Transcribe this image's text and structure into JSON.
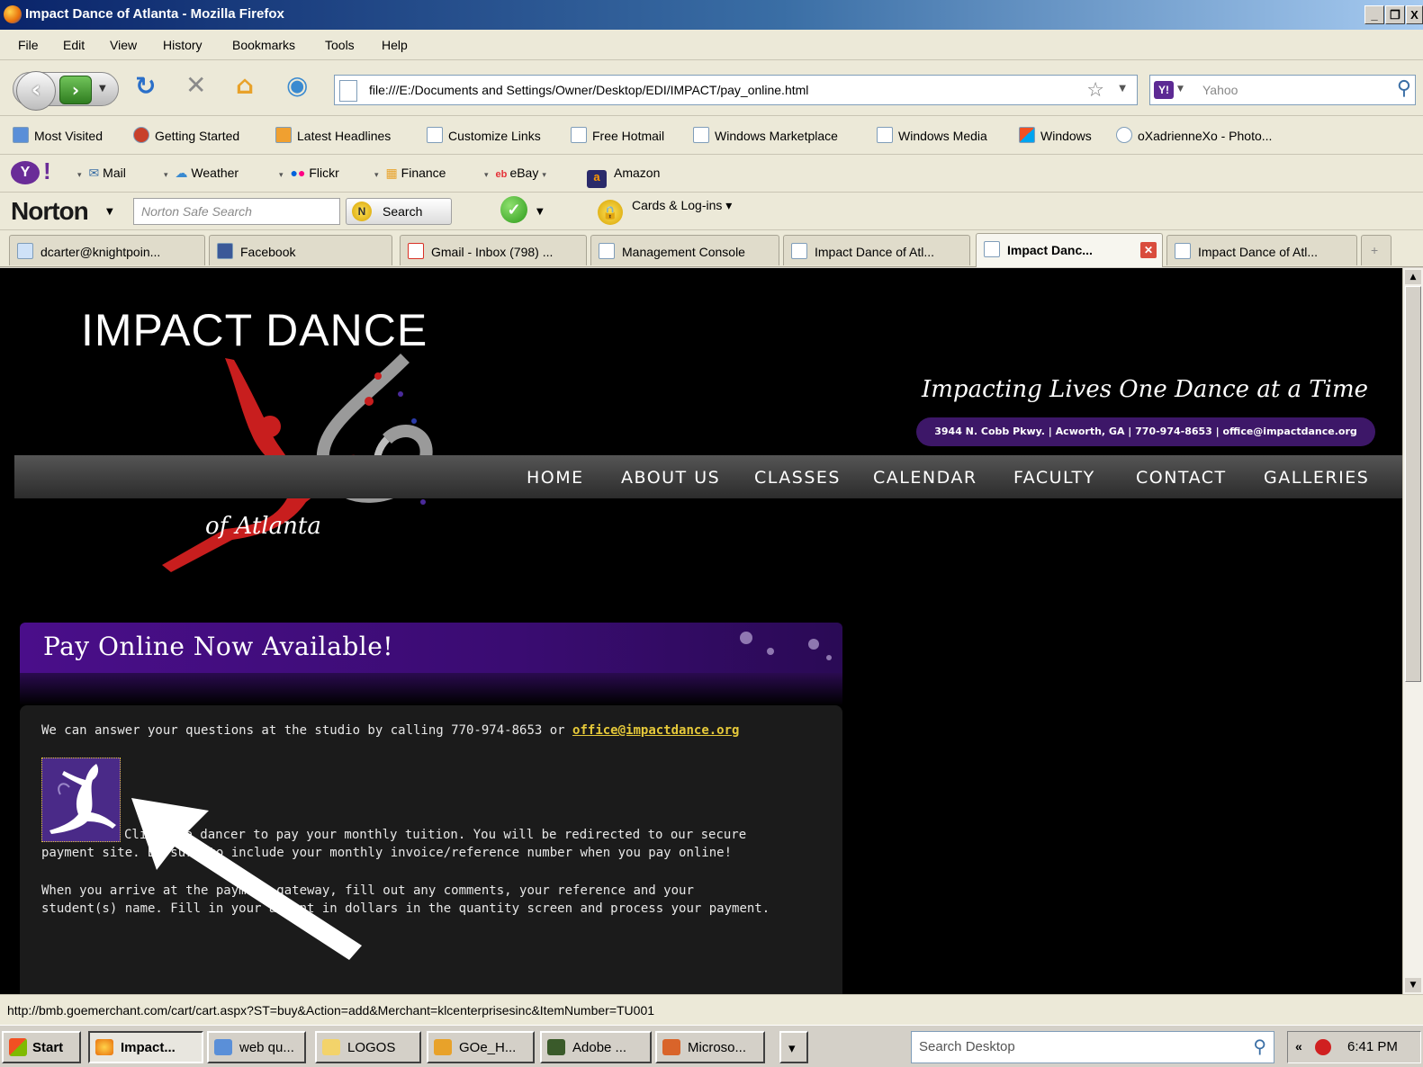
{
  "window": {
    "title": "Impact Dance of Atlanta - Mozilla Firefox",
    "controls": [
      "_",
      "❐",
      "X"
    ]
  },
  "menu": [
    "File",
    "Edit",
    "View",
    "History",
    "Bookmarks",
    "Tools",
    "Help"
  ],
  "navbar": {
    "url": "file:///E:/Documents and Settings/Owner/Desktop/EDI/IMPACT/pay_online.html",
    "search_placeholder": "Yahoo",
    "search_engine": "Y!"
  },
  "bookmarks": [
    "Most Visited",
    "Getting Started",
    "Latest Headlines",
    "Customize Links",
    "Free Hotmail",
    "Windows Marketplace",
    "Windows Media",
    "Windows",
    "oXadrienneXo - Photo..."
  ],
  "yahoo_toolbar": [
    "Mail",
    "Weather",
    "Flickr",
    "Finance",
    "eBay",
    "Amazon"
  ],
  "norton": {
    "logo": "Norton",
    "search_placeholder": "Norton Safe Search",
    "search_button": "Search",
    "cards": "Cards & Log-ins"
  },
  "tabs": [
    {
      "label": "dcarter@knightpoin...",
      "active": false
    },
    {
      "label": "Facebook",
      "active": false
    },
    {
      "label": "Gmail - Inbox (798) ...",
      "active": false
    },
    {
      "label": "Management Console",
      "active": false
    },
    {
      "label": "Impact Dance of Atl...",
      "active": false
    },
    {
      "label": "Impact Danc...",
      "active": true
    },
    {
      "label": "Impact Dance of Atl...",
      "active": false
    }
  ],
  "site": {
    "logo_title": "IMPACT DANCE",
    "logo_subtitle": "of Atlanta",
    "tagline": "Impacting Lives One Dance at a Time",
    "address": "3944 N. Cobb Pkwy. | Acworth, GA | 770-974-8653 | office@impactdance.org",
    "nav": [
      "HOME",
      "ABOUT US",
      "CLASSES",
      "CALENDAR",
      "FACULTY",
      "CONTACT",
      "GALLERIES"
    ],
    "pay_heading": "Pay Online Now Available!",
    "contact_line": "We can answer your questions at the studio by calling 770-974-8653 or",
    "contact_email": "office@impactdance.org",
    "instructions_1a": "Click the dancer to pay your monthly tuition. You will be redirected to our secure",
    "instructions_1b": "payment site. Be sure to include your monthly invoice/reference number when you pay online!",
    "instructions_2a": "When you arrive at the payment gateway, fill out any comments, your reference and your",
    "instructions_2b": "student(s) name. Fill in your amount in dollars in the quantity screen and process your payment."
  },
  "status": "http://bmb.goemerchant.com/cart/cart.aspx?ST=buy&Action=add&Merchant=klcenterprisesinc&ItemNumber=TU001",
  "taskbar": {
    "start": "Start",
    "tasks": [
      {
        "label": "Impact...",
        "active": true
      },
      {
        "label": "web qu...",
        "active": false
      },
      {
        "label": "LOGOS",
        "active": false
      },
      {
        "label": "GOe_H...",
        "active": false
      },
      {
        "label": "Adobe ...",
        "active": false
      },
      {
        "label": "Microso...",
        "active": false
      }
    ],
    "search_placeholder": "Search Desktop",
    "clock": "6:41 PM"
  },
  "colors": {
    "accent_purple": "#4a0e8a",
    "link_yellow": "#e6c93a",
    "titlebar_blue": "#0a246a"
  }
}
